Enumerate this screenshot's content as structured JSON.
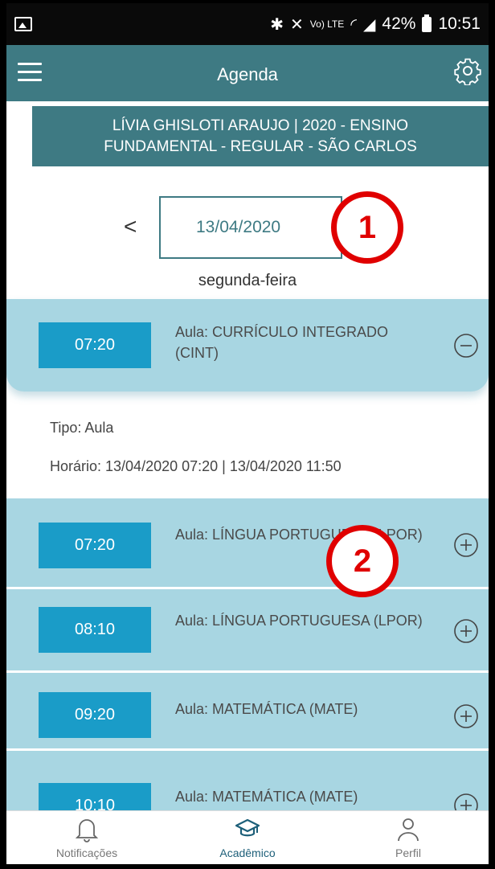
{
  "status_bar": {
    "battery": "42%",
    "time": "10:51",
    "signal": "Vo) LTE"
  },
  "header": {
    "title": "Agenda",
    "menu_icon": "menu-icon",
    "settings_icon": "gear-icon"
  },
  "banner": {
    "line1": "LÍVIA GHISLOTI ARAUJO | 2020 - ENSINO",
    "line2": "FUNDAMENTAL - REGULAR - SÃO CARLOS"
  },
  "date_picker": {
    "prev": "<",
    "date": "13/04/2020",
    "weekday": "segunda-feira"
  },
  "annotations": [
    {
      "label": "1"
    },
    {
      "label": "2"
    }
  ],
  "lessons": [
    {
      "time": "07:20",
      "title": "Aula: CURRÍCULO INTEGRADO (CINT)",
      "expanded": true,
      "details": {
        "type": "Tipo: Aula",
        "schedule": "Horário: 13/04/2020 07:20 | 13/04/2020 11:50"
      }
    },
    {
      "time": "07:20",
      "title": "Aula: LÍNGUA PORTUGUESA (LPOR)",
      "expanded": false
    },
    {
      "time": "08:10",
      "title": "Aula: LÍNGUA PORTUGUESA (LPOR)",
      "expanded": false
    },
    {
      "time": "09:20",
      "title": "Aula: MATEMÁTICA (MATE)",
      "expanded": false
    },
    {
      "time": "10:10",
      "title": "Aula: MATEMÁTICA (MATE)",
      "expanded": false
    }
  ],
  "bottom_nav": [
    {
      "label": "Notificações",
      "icon": "bell-icon",
      "active": false
    },
    {
      "label": "Acadêmico",
      "icon": "graduation-cap-icon",
      "active": true
    },
    {
      "label": "Perfil",
      "icon": "person-icon",
      "active": false
    }
  ],
  "colors": {
    "header_bg": "#3e7a83",
    "lesson_bg": "#a8d6e2",
    "time_chip": "#1a9cc8",
    "badge": "#e00000",
    "nav_active": "#1d5f79"
  }
}
